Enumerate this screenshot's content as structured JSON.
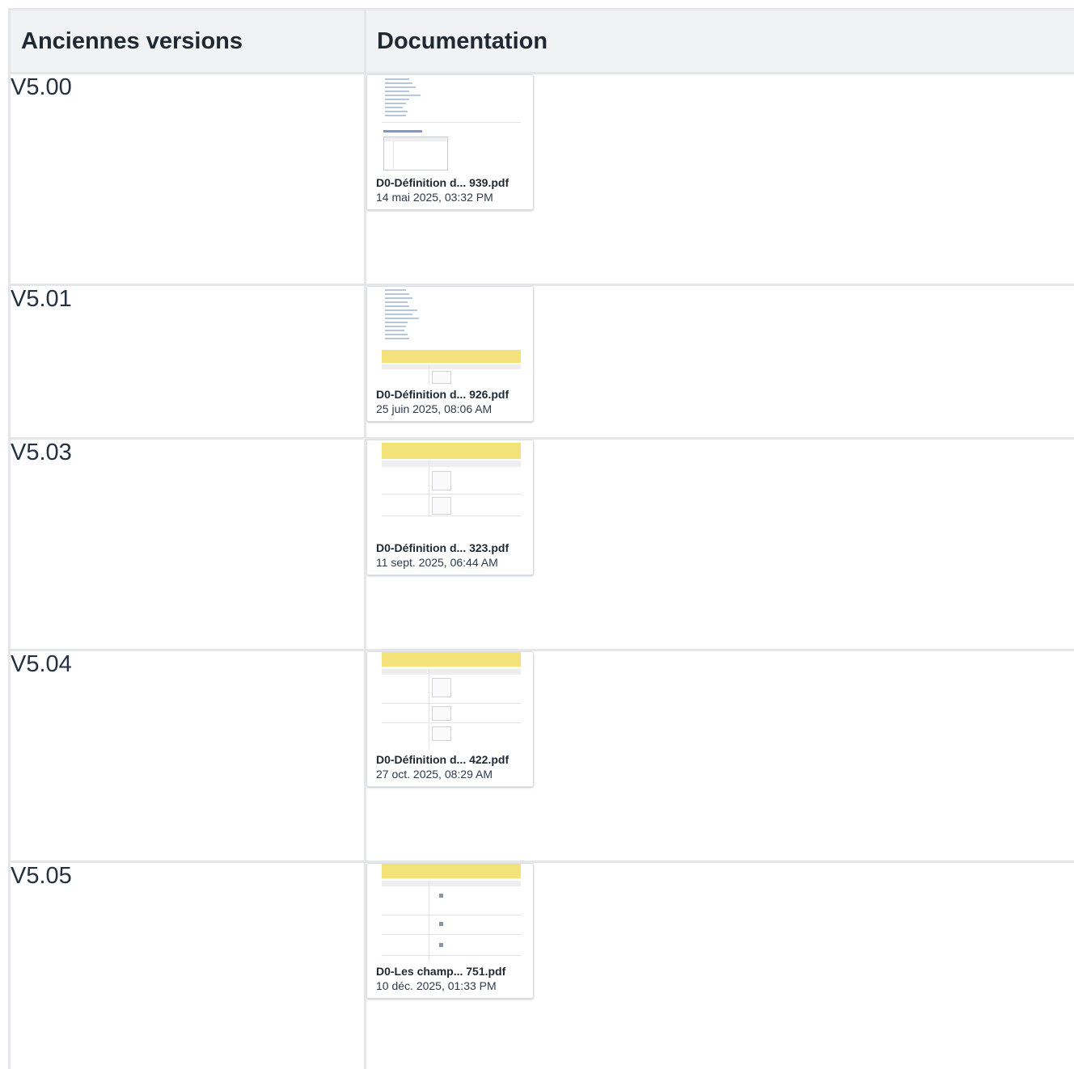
{
  "table": {
    "headers": {
      "versions": "Anciennes versions",
      "documentation": "Documentation"
    },
    "rows": [
      {
        "version": "V5.00",
        "file": {
          "name": "D0-Définition d... 939.pdf",
          "date": "14 mai 2025, 03:32 PM",
          "icon": "pdf-thumbnail-icon"
        }
      },
      {
        "version": "V5.01",
        "file": {
          "name": "D0-Définition d... 926.pdf",
          "date": "25 juin 2025, 08:06 AM",
          "icon": "pdf-thumbnail-icon"
        }
      },
      {
        "version": "V5.03",
        "file": {
          "name": "D0-Définition d... 323.pdf",
          "date": "11 sept. 2025, 06:44 AM",
          "icon": "pdf-thumbnail-icon"
        }
      },
      {
        "version": "V5.04",
        "file": {
          "name": "D0-Définition d... 422.pdf",
          "date": "27 oct. 2025, 08:29 AM",
          "icon": "pdf-thumbnail-icon"
        }
      },
      {
        "version": "V5.05",
        "file": {
          "name": "D0-Les champ... 751.pdf",
          "date": "10 déc. 2025, 01:33 PM",
          "icon": "pdf-thumbnail-icon"
        }
      }
    ]
  },
  "colors": {
    "header_bg": "#f1f2f4",
    "border": "#e4e6ea",
    "thumbnail_highlight": "#f3e27a"
  }
}
